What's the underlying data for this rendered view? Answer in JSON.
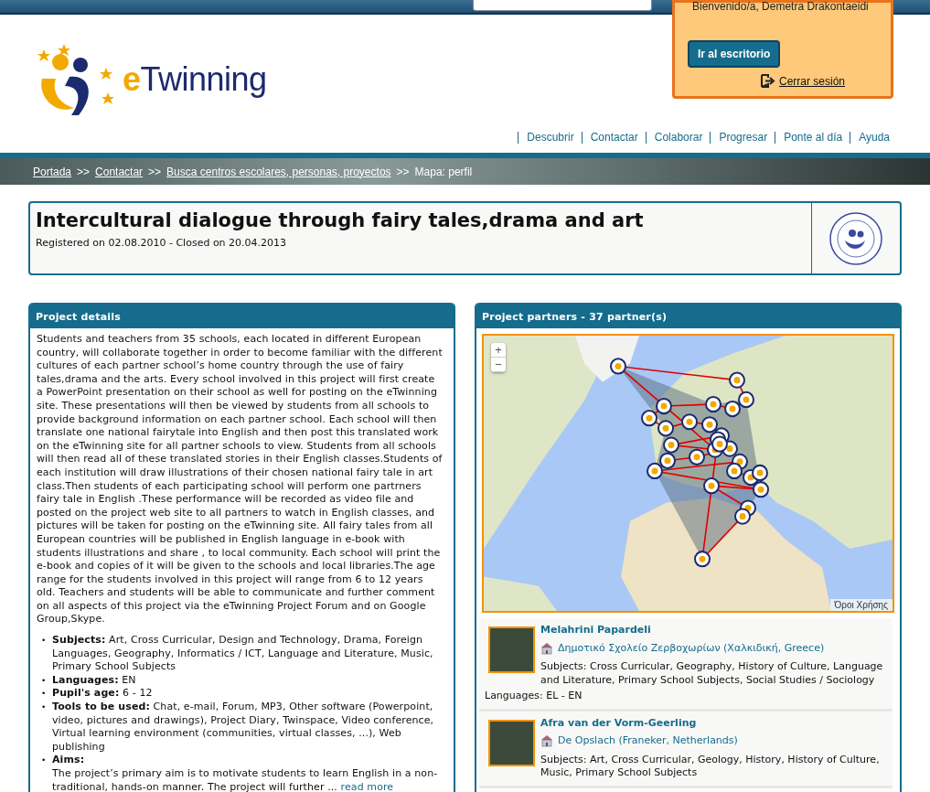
{
  "user_box": {
    "greeting": "Bienvenido/a, Demetra Drakontaeidi",
    "desk_button": "Ir al escritorio",
    "logout": "Cerrar sesión"
  },
  "logo": {
    "prefix": "e",
    "name": "Twinning"
  },
  "nav": [
    "Descubrir",
    "Contactar",
    "Colaborar",
    "Progresar",
    "Ponte al día",
    "Ayuda"
  ],
  "breadcrumb": {
    "separator": ">>",
    "items": [
      {
        "label": "Portada",
        "link": true
      },
      {
        "label": "Contactar",
        "link": true
      },
      {
        "label": "Busca centros escolares, personas, proyectos",
        "link": true
      },
      {
        "label": "Mapa: perfil",
        "link": false
      }
    ]
  },
  "project": {
    "title": "Intercultural dialogue through fairy tales,drama and art",
    "dates": "Registered on 02.08.2010 - Closed on 20.04.2013"
  },
  "details": {
    "heading": "Project details",
    "description": "Students and teachers from 35 schools, each located in different European country, will collaborate together in order to become familiar with the different cultures of each partner school’s home country through the use of fairy tales,drama and the arts. Every school involved in this project will first create a PowerPoint presentation on their school as well for posting on the eTwinning site. These presentations will then be viewed by students from all schools to provide background information on each partner school. Each school will then translate one national fairytale into English and then post this translated work on the eTwinning site for all partner schools to view. Students from all schools will then read all of these translated stories in their English classes.Students of each institution will draw illustrations of their chosen national fairy tale in art class.Then students of each participating school will perform one partrners fairy tale in English .These performance will be recorded as video file and posted on the project web site to all partners to watch in English classes, and pictures will be taken for posting on the eTwinning site. All fairy tales from all European countries will be published in English language in e-book with students illustrations and share , to local community. Each school will print the e-book and copies of it will be given to the schools and local libraries.The age range for the students involved in this project will range from 6 to 12 years old. Teachers and students will be able to communicate and further comment on all aspects of this project via the eTwinning Project Forum and on Google Group,Skype.",
    "bullet": "•",
    "facts": [
      {
        "label": "Subjects:",
        "value": "Art, Cross Curricular, Design and Technology, Drama, Foreign Languages, Geography, Informatics / ICT, Language and Literature, Music, Primary School Subjects"
      },
      {
        "label": "Languages:",
        "value": "EN"
      },
      {
        "label": "Pupil's age:",
        "value": "6 - 12"
      },
      {
        "label": "Tools to be used:",
        "value": "Chat, e-mail, Forum, MP3, Other software (Powerpoint, video, pictures and drawings), Project Diary, Twinspace, Video conference, Virtual learning environment (communities, virtual classes, ...), Web publishing"
      }
    ],
    "aims": {
      "label": "Aims:",
      "text": "The project’s primary aim is to motivate students to learn English in a non-traditional, hands-on manner. The project will further ...",
      "more": "read more"
    }
  },
  "partners": {
    "heading": "Project partners - 37 partner(s)",
    "map_terms": "Όροι Χρήσης",
    "zoom_in": "+",
    "zoom_out": "−",
    "items": [
      {
        "name": "Melahrini Papardeli",
        "school": "Δημοτικό Σχολείο Ζερβοχωρίων (Χαλκιδική, Greece)",
        "subjects": "Subjects: Cross Curricular, Geography, History of Culture, Language and Literature, Primary School Subjects, Social Studies / Sociology",
        "languages": "Languages: EL - EN"
      },
      {
        "name": "Afra van der Vorm-Geerling",
        "school": "De Opslach (Franeker, Netherlands)",
        "subjects": "Subjects: Art, Cross Curricular, Geology, History, History of Culture, Music, Primary School Subjects"
      }
    ]
  }
}
